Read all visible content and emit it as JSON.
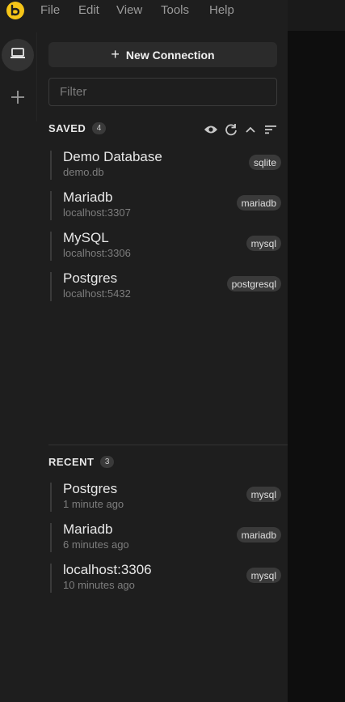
{
  "menu": {
    "items": [
      "File",
      "Edit",
      "View",
      "Tools",
      "Help"
    ]
  },
  "colors": {
    "brand": "#f5c518",
    "panel": "#1e1e1e",
    "tag": "#3a3a3a"
  },
  "toolbar": {
    "new_connection_label": "New Connection",
    "filter_placeholder": "Filter"
  },
  "saved": {
    "title": "SAVED",
    "count": "4",
    "items": [
      {
        "name": "Demo Database",
        "sub": "demo.db",
        "tag": "sqlite"
      },
      {
        "name": "Mariadb",
        "sub": "localhost:3307",
        "tag": "mariadb"
      },
      {
        "name": "MySQL",
        "sub": "localhost:3306",
        "tag": "mysql"
      },
      {
        "name": "Postgres",
        "sub": "localhost:5432",
        "tag": "postgresql"
      }
    ]
  },
  "recent": {
    "title": "RECENT",
    "count": "3",
    "items": [
      {
        "name": "Postgres",
        "sub": "1 minute ago",
        "tag": "mysql"
      },
      {
        "name": "Mariadb",
        "sub": "6 minutes ago",
        "tag": "mariadb"
      },
      {
        "name": "localhost:3306",
        "sub": "10 minutes ago",
        "tag": "mysql"
      }
    ]
  },
  "icons": {
    "logo": "beekeeper-logo-icon",
    "rail": [
      "laptop-icon",
      "plus-icon"
    ],
    "tools": [
      "eye-icon",
      "refresh-icon",
      "chevron-up-icon",
      "sort-icon"
    ]
  }
}
